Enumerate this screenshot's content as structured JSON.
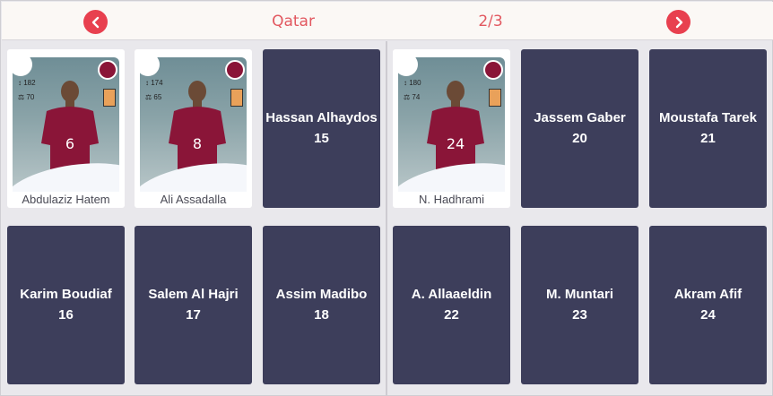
{
  "header": {
    "team": "Qatar",
    "page": "2/3",
    "prev_icon": "chevron-left-icon",
    "next_icon": "chevron-right-icon",
    "accent": "#e8404f"
  },
  "cards": [
    {
      "name": "Abdulaziz Hatem",
      "number": "6",
      "photo": true,
      "height": "182",
      "weight": "70"
    },
    {
      "name": "Ali Assadalla",
      "number": "8",
      "photo": true,
      "height": "174",
      "weight": "65"
    },
    {
      "name": "Hassan Alhaydos",
      "number": "15",
      "photo": false
    },
    {
      "name": "N. Hadhrami",
      "number": "24",
      "photo": true,
      "height": "180",
      "weight": "74"
    },
    {
      "name": "Jassem Gaber",
      "number": "20",
      "photo": false
    },
    {
      "name": "Moustafa Tarek",
      "number": "21",
      "photo": false
    },
    {
      "name": "Karim Boudiaf",
      "number": "16",
      "photo": false
    },
    {
      "name": "Salem Al Hajri",
      "number": "17",
      "photo": false
    },
    {
      "name": "Assim Madibo",
      "number": "18",
      "photo": false
    },
    {
      "name": "A. Allaaeldin",
      "number": "22",
      "photo": false
    },
    {
      "name": "M. Muntari",
      "number": "23",
      "photo": false
    },
    {
      "name": "Akram Afif",
      "number": "24",
      "photo": false
    }
  ]
}
